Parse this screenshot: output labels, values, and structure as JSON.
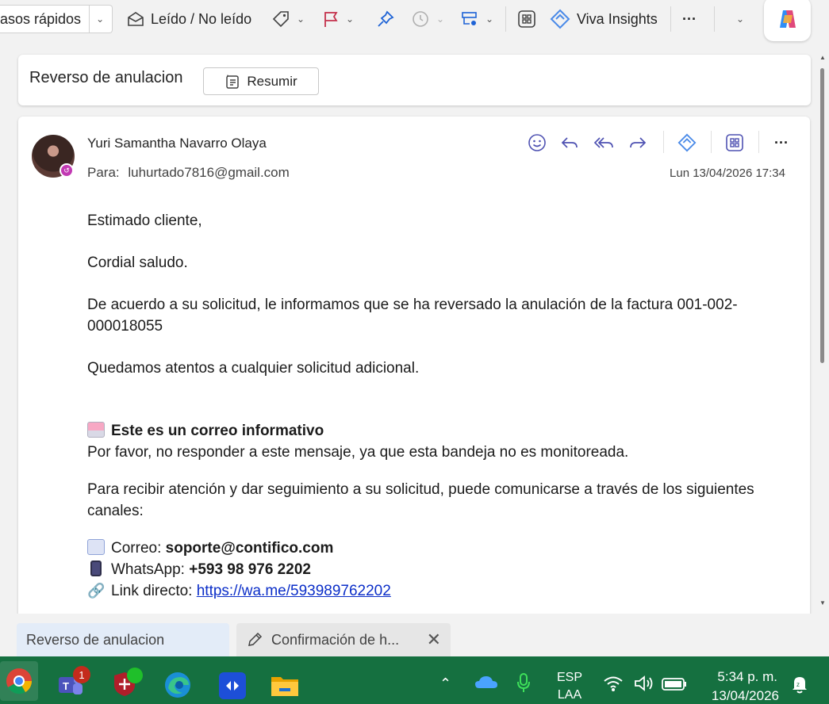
{
  "toolbar": {
    "quick_steps_label": "asos rápidos",
    "read_unread_label": "Leído / No leído",
    "viva_insights_label": "Viva Insights",
    "more_label": "···"
  },
  "subject": {
    "title": "Reverso de anulacion",
    "summarize_label": "Resumir"
  },
  "email": {
    "sender": "Yuri Samantha Navarro Olaya",
    "to_label": "Para:",
    "to_address": "luhurtado7816@gmail.com",
    "date": "Lun 13/04/2026 17:34",
    "greeting": "Estimado cliente,",
    "salutation": "Cordial saludo.",
    "paragraph1": "De acuerdo a su solicitud, le informamos que se ha reversado la anulación de la factura 001-002-000018055",
    "paragraph2": "Quedamos atentos a cualquier solicitud adicional.",
    "notice_title": "Este es un correo informativo",
    "notice_text": "Por favor, no responder a este mensaje, ya que esta bandeja no es monitoreada.",
    "channels_intro": "Para recibir atención y dar seguimiento a su solicitud, puede comunicarse a través de los siguientes canales:",
    "email_label": "Correo:",
    "email_value": "soporte@contifico.com",
    "whatsapp_label": "WhatsApp:",
    "whatsapp_value": "+593 98 976 2202",
    "link_label": "Link directo:",
    "link_value": "https://wa.me/593989762202"
  },
  "tabs": [
    {
      "label": "Reverso de anulacion"
    },
    {
      "label": "Confirmación de h..."
    }
  ],
  "taskbar": {
    "teams_badge": "1",
    "language_top": "ESP",
    "language_bottom": "LAA",
    "time": "5:34 p. m.",
    "date": "13/04/2026"
  },
  "colors": {
    "accent": "#4f52b2",
    "taskbar": "#157040",
    "link": "#0b2ec8",
    "presence": "#c239b3"
  }
}
